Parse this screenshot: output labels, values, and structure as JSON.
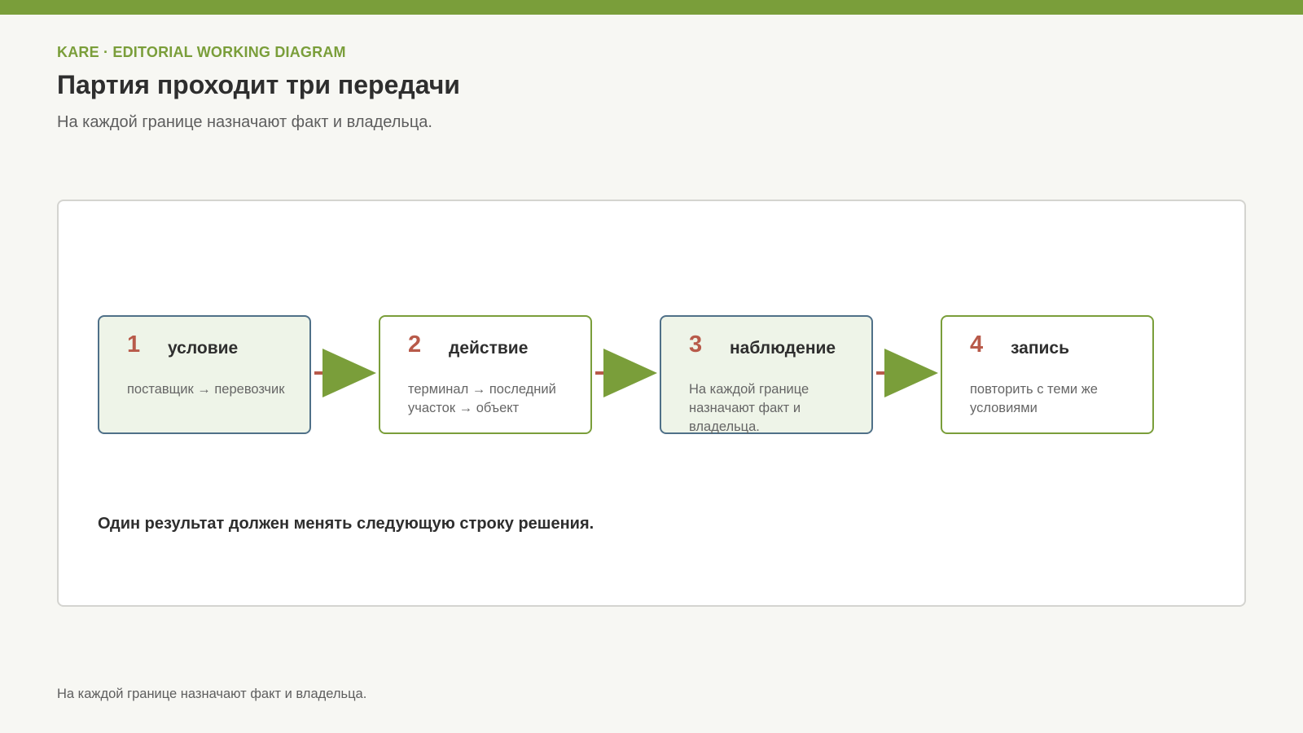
{
  "header": {
    "kicker": "KARE · EDITORIAL WORKING DIAGRAM",
    "title": "Партия проходит три передачи",
    "subtitle": "На каждой границе назначают факт и владельца."
  },
  "diagram": {
    "steps": [
      {
        "number": "1",
        "label": "условие",
        "description": "поставщик → перевозчик"
      },
      {
        "number": "2",
        "label": "действие",
        "description": "терминал → последний участок → объект"
      },
      {
        "number": "3",
        "label": "наблюдение",
        "description": "На каждой границе назначают факт и владельца."
      },
      {
        "number": "4",
        "label": "запись",
        "description": "повторить с теми же условиями"
      }
    ],
    "note": "Один результат должен менять следующую строку решения."
  },
  "footer": {
    "text": "На каждой границе назначают факт и владельца."
  },
  "colors": {
    "accent_green": "#7a9e3a",
    "number_red": "#b85a4a",
    "border_blue": "#4f7088",
    "fill_light_green": "#eef4e8",
    "connector_red": "#b85a4a"
  }
}
